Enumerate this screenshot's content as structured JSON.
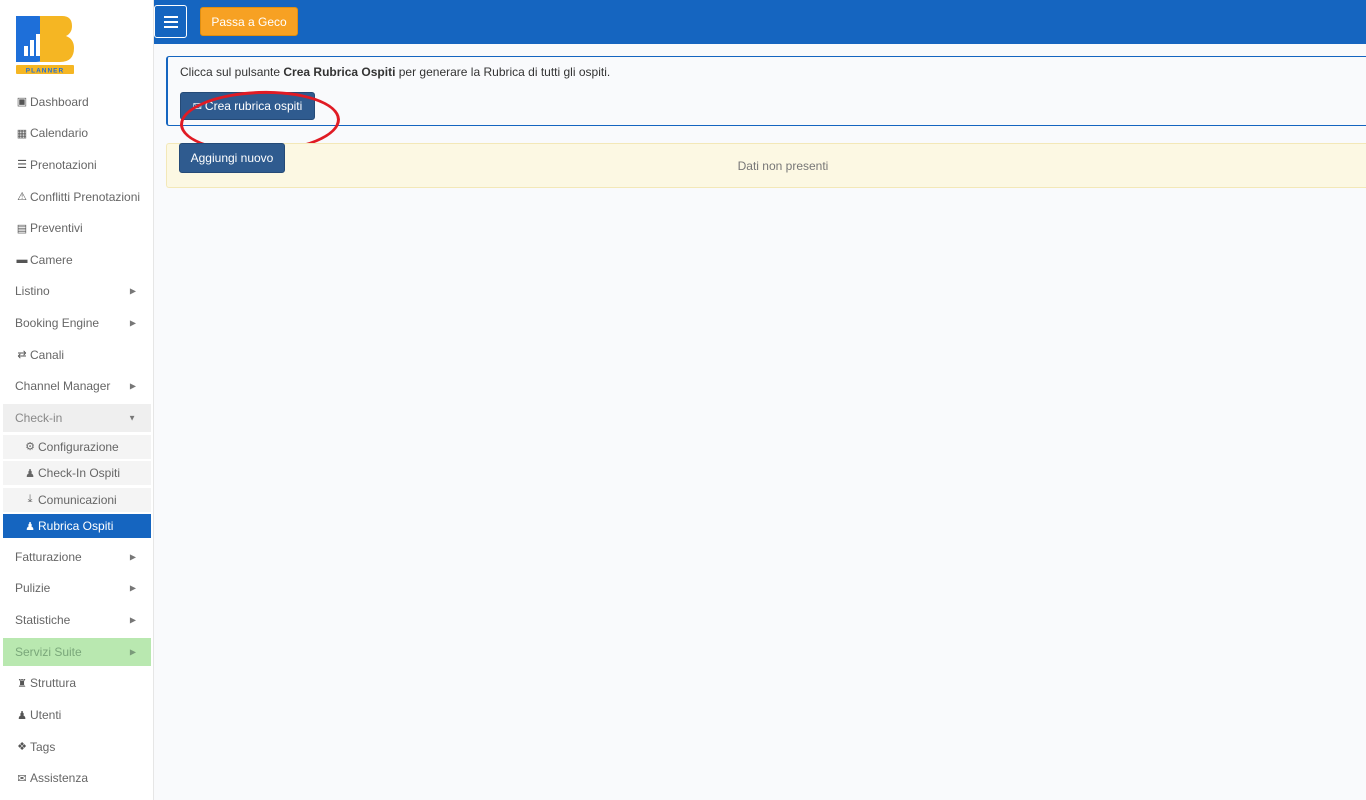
{
  "logo": {
    "alt": "BB Planner",
    "text": "PLANNER"
  },
  "topbar": {
    "menu_label": "",
    "geco_label": "Passa a Geco"
  },
  "sidebar": {
    "items": [
      {
        "label": "Dashboard",
        "icon": "dashboard-icon"
      },
      {
        "label": "Calendario",
        "icon": "calendar-icon"
      },
      {
        "label": "Prenotazioni",
        "icon": "list-icon"
      },
      {
        "label": "Conflitti Prenotazioni",
        "icon": "warning-icon"
      },
      {
        "label": "Preventivi",
        "icon": "document-icon"
      },
      {
        "label": "Camere",
        "icon": "bed-icon"
      },
      {
        "label": "Listino",
        "icon": ""
      },
      {
        "label": "Booking Engine",
        "icon": ""
      },
      {
        "label": "Canali",
        "icon": "shuffle-icon"
      },
      {
        "label": "Channel Manager",
        "icon": ""
      },
      {
        "label": "Check-in",
        "icon": ""
      }
    ],
    "checkin_sub": [
      {
        "label": "Configurazione",
        "icon": "gear-icon"
      },
      {
        "label": "Check-In Ospiti",
        "icon": "user-icon"
      },
      {
        "label": "Comunicazioni",
        "icon": "download-icon"
      },
      {
        "label": "Rubrica Ospiti",
        "icon": "user-icon"
      }
    ],
    "items_after": [
      {
        "label": "Fatturazione",
        "icon": ""
      },
      {
        "label": "Pulizie",
        "icon": ""
      },
      {
        "label": "Statistiche",
        "icon": ""
      },
      {
        "label": "Servizi Suite",
        "icon": ""
      },
      {
        "label": "Struttura",
        "icon": "building-icon"
      },
      {
        "label": "Utenti",
        "icon": "user-icon"
      },
      {
        "label": "Tags",
        "icon": "tags-icon"
      },
      {
        "label": "Assistenza",
        "icon": "envelope-icon"
      }
    ]
  },
  "main": {
    "info_prefix": "Clicca sul pulsante ",
    "info_bold": "Crea Rubrica Ospiti",
    "info_suffix": " per generare la Rubrica di tutti gli ospiti.",
    "crea_button": "Crea rubrica ospiti",
    "add_button": "Aggiungi nuovo",
    "empty_text": "Dati non presenti"
  },
  "colors": {
    "primary": "#1565c0",
    "orange": "#f7a123",
    "button": "#2f5b8f",
    "highlight": "#e01b24",
    "green": "#b9e8b0",
    "warning_bg": "#fcf8e3"
  }
}
